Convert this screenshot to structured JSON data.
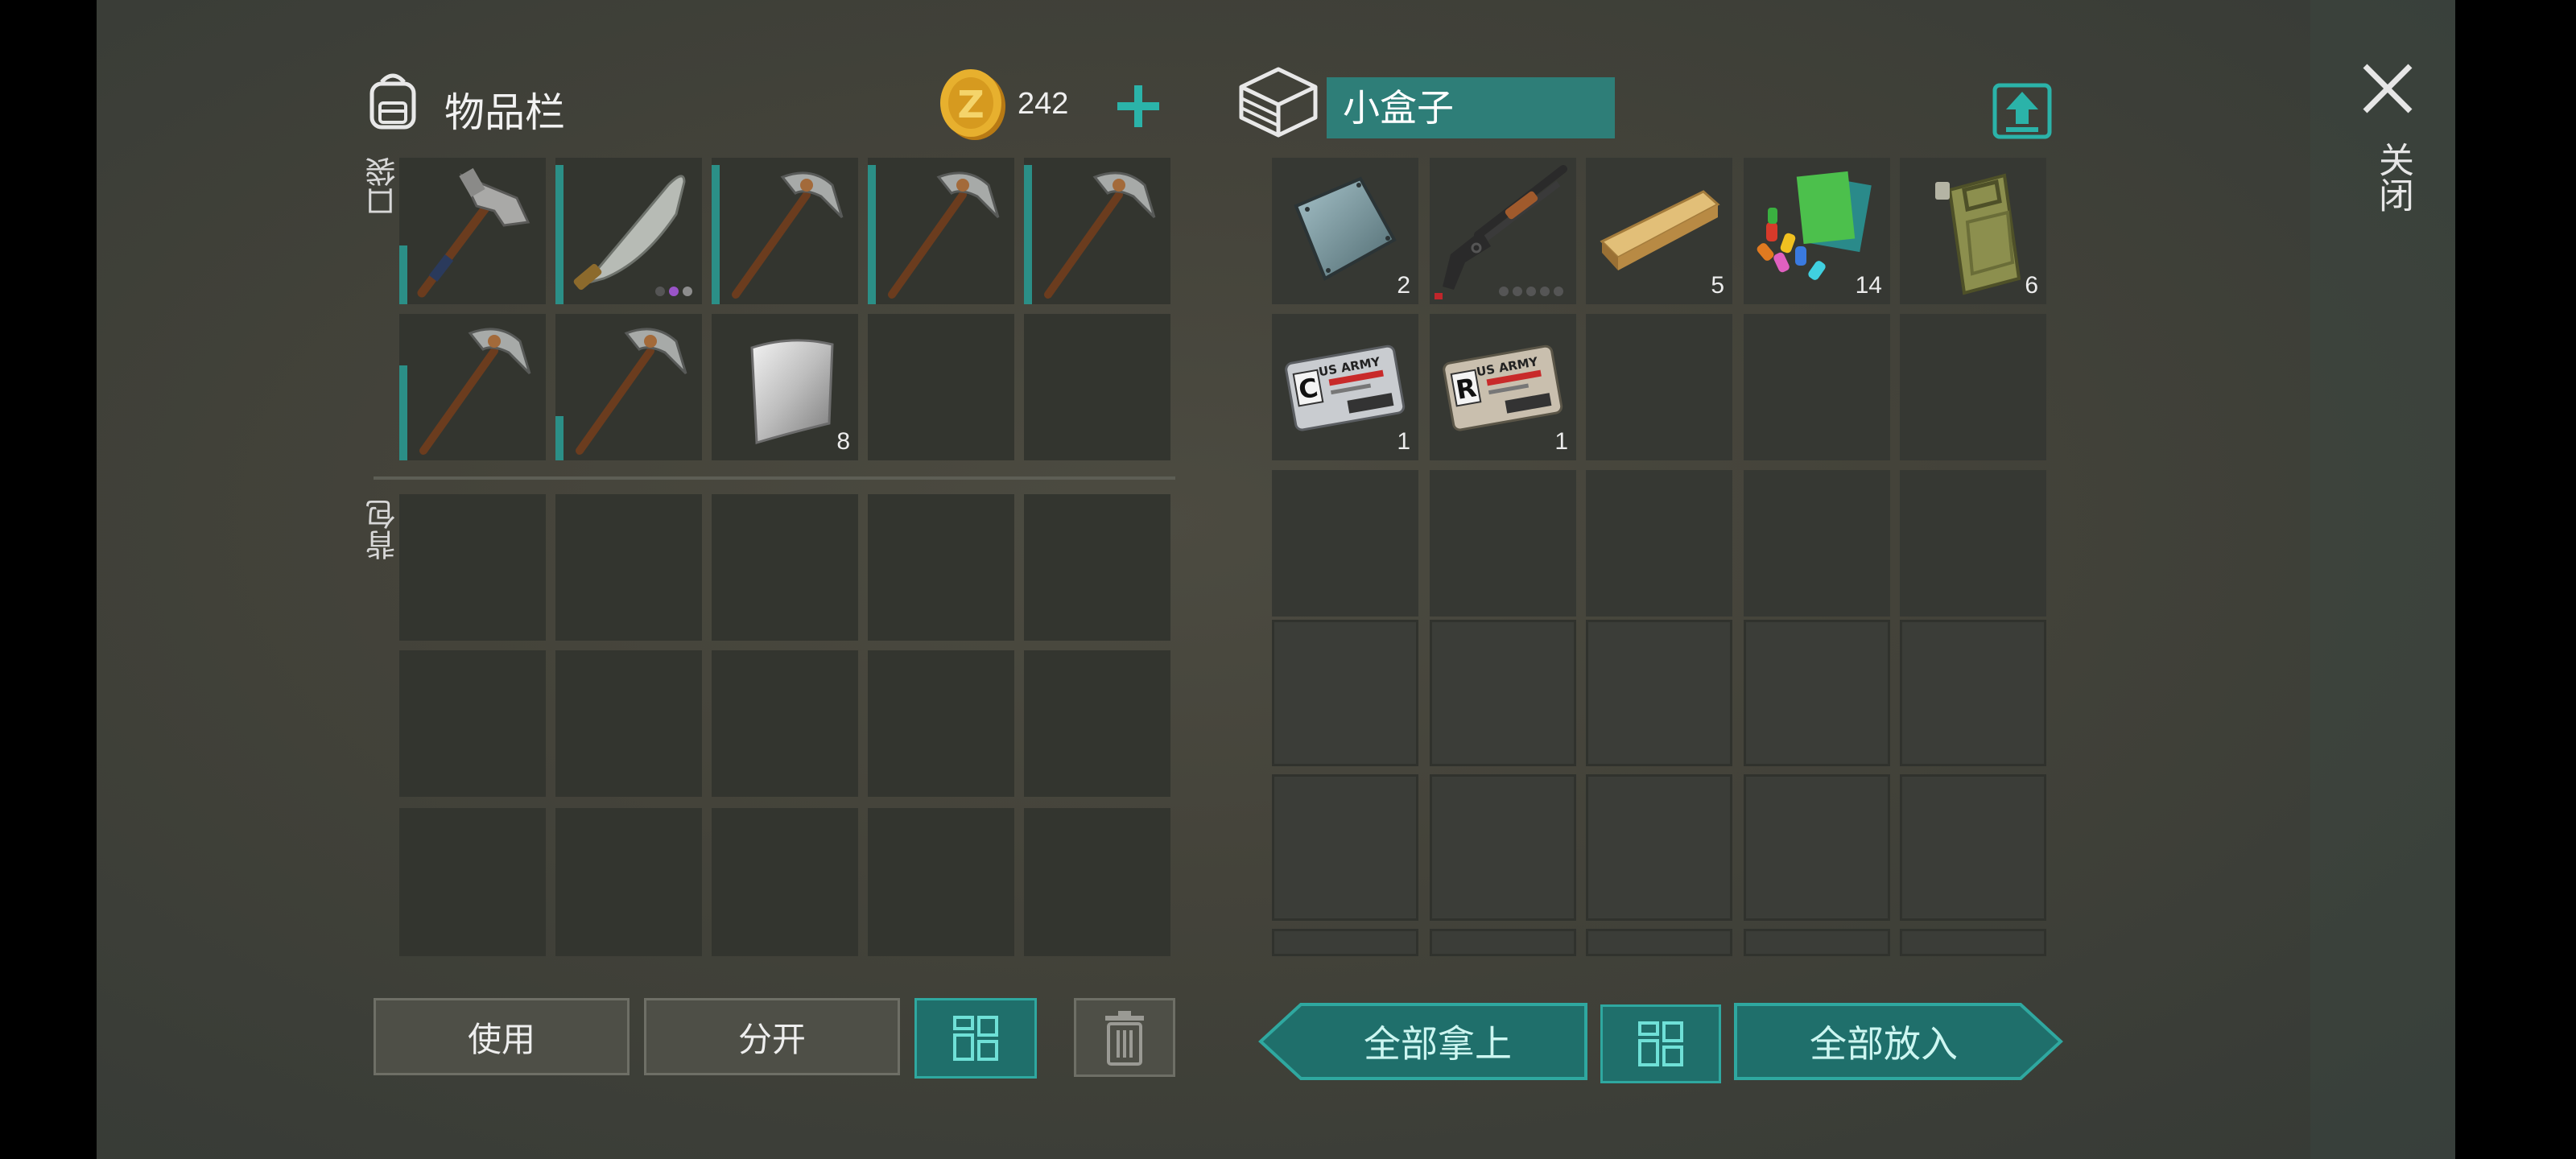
{
  "inventory": {
    "title": "物品栏",
    "coins": "242",
    "pocket_label": "口袋",
    "backpack_label": "背包",
    "pocket_slots": [
      {
        "item": "hammer",
        "qty": "",
        "durability": 0.4
      },
      {
        "item": "machete",
        "qty": "",
        "durability": 0.95
      },
      {
        "item": "pickaxe",
        "qty": "",
        "durability": 0.95
      },
      {
        "item": "pickaxe",
        "qty": "",
        "durability": 0.95
      },
      {
        "item": "pickaxe",
        "qty": "",
        "durability": 0.95
      },
      {
        "item": "pickaxe",
        "qty": "",
        "durability": 0.65
      },
      {
        "item": "pickaxe",
        "qty": "",
        "durability": 0.3
      },
      {
        "item": "metal-sheet",
        "qty": "8",
        "durability": 0
      },
      {
        "item": "",
        "qty": "",
        "durability": 0
      },
      {
        "item": "",
        "qty": "",
        "durability": 0
      }
    ]
  },
  "container": {
    "name": "小盒子",
    "slots": [
      {
        "item": "steel-plate",
        "qty": "2"
      },
      {
        "item": "shotgun",
        "qty": ""
      },
      {
        "item": "wood-plank",
        "qty": "5"
      },
      {
        "item": "paint-kit",
        "qty": "14"
      },
      {
        "item": "jerrycan",
        "qty": "6"
      },
      {
        "item": "us-army-card-c",
        "qty": "1"
      },
      {
        "item": "us-army-card-r",
        "qty": "1"
      }
    ],
    "card_header": "US ARMY"
  },
  "buttons": {
    "use": "使用",
    "split": "分开",
    "take_all": "全部拿上",
    "put_all": "全部放入",
    "close": "关闭"
  },
  "colors": {
    "accent": "#2b8f87",
    "teal_button": "#1f6f6b",
    "slot": "#33352f",
    "coin": "#e0a82a"
  }
}
